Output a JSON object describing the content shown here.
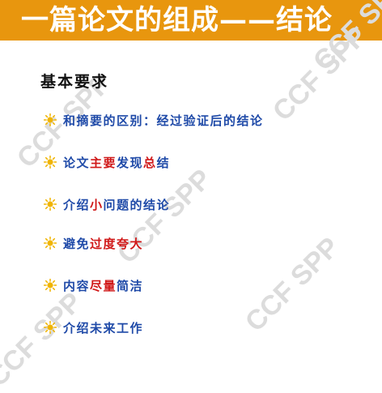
{
  "title": "一篇论文的组成——结论",
  "watermark": "CCF SPP",
  "heading": "基本要求",
  "colors": {
    "title_bar": "#e8960e",
    "text_blue": "#1f4aa8",
    "text_red": "#d01818",
    "bullet_icon": "#f0b400"
  },
  "bullets": [
    {
      "icon": "sun-icon",
      "parts": [
        {
          "text": "和摘要的区别：经过验证后的结论",
          "color": "blue"
        }
      ]
    },
    {
      "icon": "sun-icon",
      "parts": [
        {
          "text": "论文",
          "color": "blue"
        },
        {
          "text": "主要",
          "color": "red"
        },
        {
          "text": "发现",
          "color": "blue"
        },
        {
          "text": "总",
          "color": "red"
        },
        {
          "text": "结",
          "color": "blue"
        }
      ]
    },
    {
      "icon": "sun-icon",
      "parts": [
        {
          "text": "介绍",
          "color": "blue"
        },
        {
          "text": "小",
          "color": "red"
        },
        {
          "text": "问题",
          "color": "blue"
        },
        {
          "text": "的结论",
          "color": "blue"
        }
      ]
    },
    {
      "icon": "sun-icon",
      "parts": [
        {
          "text": "避免",
          "color": "blue"
        },
        {
          "text": "过度夸大",
          "color": "red"
        }
      ]
    },
    {
      "icon": "sun-icon",
      "parts": [
        {
          "text": "内容",
          "color": "blue"
        },
        {
          "text": "尽量",
          "color": "red"
        },
        {
          "text": "简洁",
          "color": "blue"
        }
      ]
    },
    {
      "icon": "sun-icon",
      "parts": [
        {
          "text": "介绍",
          "color": "blue"
        },
        {
          "text": "未来工作",
          "color": "blue"
        }
      ]
    }
  ]
}
